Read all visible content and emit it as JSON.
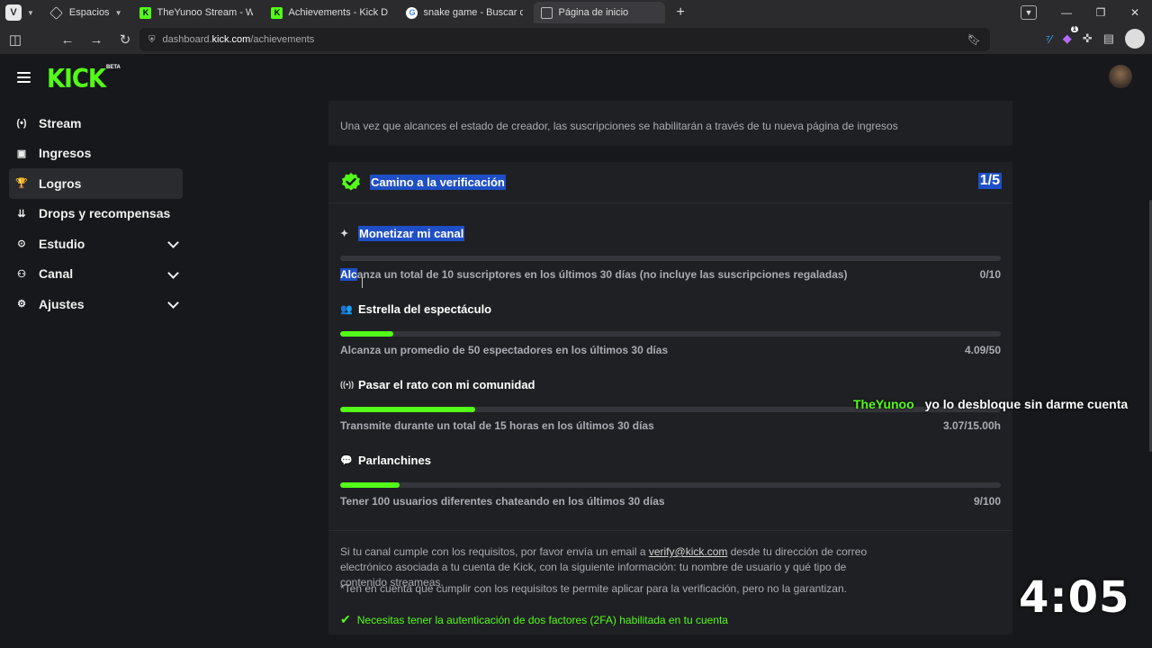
{
  "browser": {
    "workspaces_label": "Espacios",
    "tabs": [
      {
        "title": "TheYunoo Stream - Watch",
        "favicon": "kick"
      },
      {
        "title": "Achievements - Kick Dashb",
        "favicon": "kick"
      },
      {
        "title": "snake game - Buscar con G",
        "favicon": "google"
      },
      {
        "title": "Página de inicio",
        "favicon": "grid"
      }
    ],
    "active_tab": 3,
    "url_prefix": "dashboard.",
    "url_host": "kick.com",
    "url_path": "/achievements",
    "extension_badge": "1"
  },
  "kick": {
    "logo": "KICK",
    "beta": "BETA"
  },
  "sidebar": {
    "items": [
      {
        "label": "Stream",
        "icon": "(•)"
      },
      {
        "label": "Ingresos",
        "icon": "▣"
      },
      {
        "label": "Logros",
        "icon": "🏆"
      },
      {
        "label": "Drops y recompensas",
        "icon": "⇊"
      },
      {
        "label": "Estudio",
        "icon": "⊙"
      },
      {
        "label": "Canal",
        "icon": "⚇"
      },
      {
        "label": "Ajustes",
        "icon": "⚙"
      }
    ]
  },
  "note": {
    "text": "Una vez que alcances el estado de creador, las suscripciones se habilitarán a través de tu nueva página de ingresos"
  },
  "verification": {
    "title": "Camino a la verificación",
    "count": "1/5",
    "accent_color": "#53fc18",
    "achievements": [
      {
        "title": "Monetizar mi canal",
        "icon": "✦",
        "desc": "Alcanza un total de 10 suscriptores en los últimos 30 días (no incluye las suscripciones regaladas)",
        "value": "0/10",
        "progress": 0.0
      },
      {
        "title": "Estrella del espectáculo",
        "icon": "👥",
        "desc": "Alcanza un promedio de 50 espectadores en los últimos 30 días",
        "value": "4.09/50",
        "progress": 0.08
      },
      {
        "title": "Pasar el rato con mi comunidad",
        "icon": "((•))",
        "desc": "Transmite durante un total de 15 horas en los últimos 30 días",
        "value": "3.07/15.00h",
        "progress": 0.205
      },
      {
        "title": "Parlanchines",
        "icon": "💬",
        "desc": "Tener 100 usuarios diferentes chateando en los últimos 30 días",
        "value": "9/100",
        "progress": 0.09
      }
    ],
    "footer": {
      "p1_before": "Si tu canal cumple con los requisitos, por favor envía un email a ",
      "email": "verify@kick.com",
      "p1_after": " desde tu dirección de correo electrónico asociada a tu cuenta de Kick, con la siguiente información: tu nombre de usuario y qué tipo de contenido streameas.",
      "p2": "*Ten en cuenta que cumplir con los requisitos te permite aplicar para la verificación, pero no la garantizan.",
      "requirement": "Necesitas tener la autenticación de dos factores (2FA) habilitada en tu cuenta"
    }
  },
  "overlay": {
    "chat_user": "TheYunoo",
    "chat_message": "yo lo desbloque sin darme cuenta",
    "timer": "4:05"
  }
}
